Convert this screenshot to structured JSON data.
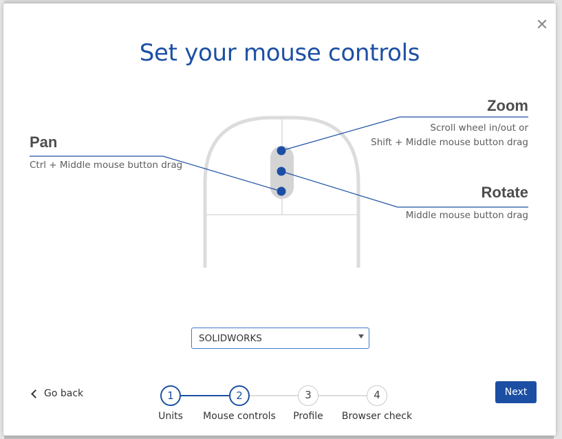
{
  "dialog": {
    "title": "Set your mouse controls",
    "close_icon": "close-icon"
  },
  "controls": {
    "pan": {
      "title": "Pan",
      "desc": "Ctrl + Middle mouse button drag"
    },
    "zoom": {
      "title": "Zoom",
      "desc_line1": "Scroll wheel in/out or",
      "desc_line2": "Shift + Middle mouse button drag"
    },
    "rotate": {
      "title": "Rotate",
      "desc": "Middle mouse button drag"
    }
  },
  "preset_select": {
    "value": "SOLIDWORKS"
  },
  "footer": {
    "back_label": "Go back",
    "next_label": "Next"
  },
  "steps": [
    {
      "number": "1",
      "label": "Units",
      "state": "complete"
    },
    {
      "number": "2",
      "label": "Mouse controls",
      "state": "current"
    },
    {
      "number": "3",
      "label": "Profile",
      "state": "upcoming"
    },
    {
      "number": "4",
      "label": "Browser check",
      "state": "upcoming"
    }
  ],
  "colors": {
    "accent": "#1c4fa4",
    "mouse_outline": "#dcdcdc",
    "dot": "#1c4fa4"
  }
}
